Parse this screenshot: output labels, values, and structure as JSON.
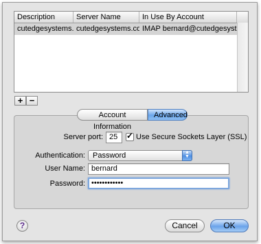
{
  "table": {
    "headers": [
      "Description",
      "Server Name",
      "In Use By Account"
    ],
    "rows": [
      [
        "cutedgesystems....",
        "cutedgesystems.com",
        "IMAP bernard@cutedgesyst..."
      ]
    ]
  },
  "list_buttons": {
    "add": "+",
    "remove": "−"
  },
  "tabs": [
    {
      "label": "Account Information",
      "active": false
    },
    {
      "label": "Advanced",
      "active": true
    }
  ],
  "form": {
    "server_port_label": "Server port:",
    "server_port_value": "25",
    "ssl_label": "Use Secure Sockets Layer (SSL)",
    "ssl_checked": true,
    "ssl_check_glyph": "✓",
    "auth_label": "Authentication:",
    "auth_value": "Password",
    "user_label": "User Name:",
    "user_value": "bernard",
    "password_label": "Password:",
    "password_value": "••••••••••••"
  },
  "footer": {
    "help": "?",
    "cancel": "Cancel",
    "ok": "OK"
  },
  "colors": {
    "selected_row": "#d4d4d4",
    "accent": "#6aa5ea"
  }
}
